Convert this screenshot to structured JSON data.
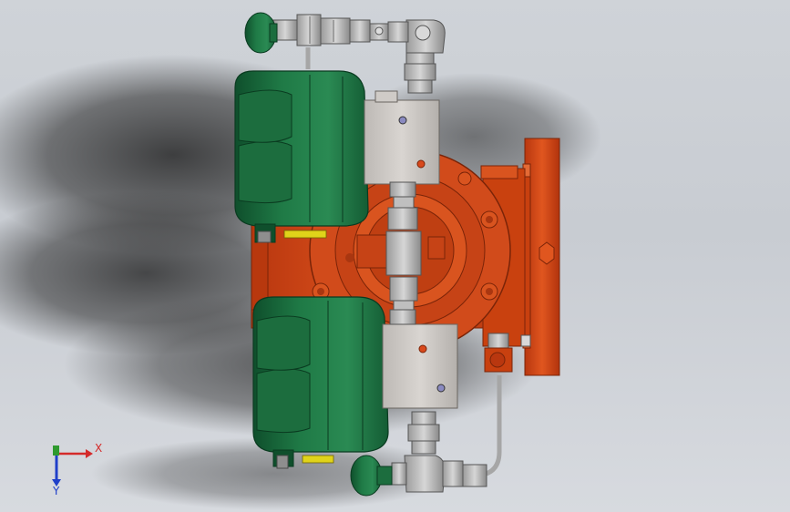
{
  "viewport": {
    "background_colors": [
      "#c8ccd2",
      "#d7dadf"
    ],
    "shadow_color": "#2b2b2b"
  },
  "colors": {
    "housing_orange": "#d8491c",
    "housing_orange_dark": "#a3300f",
    "motor_green": "#1f7a46",
    "motor_green_dark": "#0f4f2c",
    "steel": "#c9c9c9",
    "steel_dark": "#7d7d7d",
    "brass_yellow": "#e0d31a"
  },
  "triad": {
    "x_label": "X",
    "y_label": "Y",
    "x_color": "#d42a2a",
    "y_color": "#2f9a2f",
    "z_color": "#1f3fc9"
  },
  "parts": {
    "model_description_icon": "assembly-3d-model-icon"
  }
}
